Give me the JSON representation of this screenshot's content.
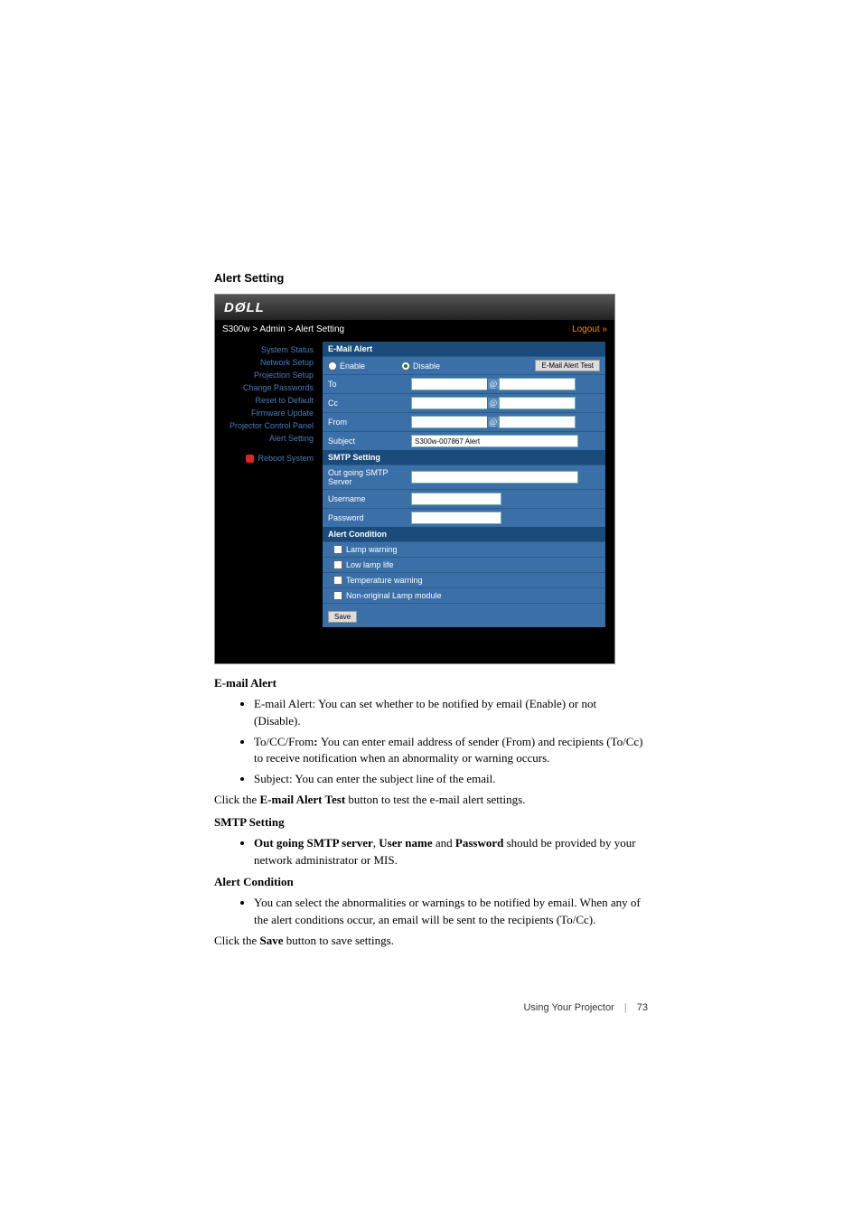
{
  "title": "Alert Setting",
  "screenshot": {
    "logo": "DØLL",
    "breadcrumb": "S300w > Admin > Alert Setting",
    "logout": "Logout »",
    "sidebar": {
      "items": [
        {
          "label": "System Status"
        },
        {
          "label": "Network Setup"
        },
        {
          "label": "Projection Setup"
        },
        {
          "label": "Change Passwords"
        },
        {
          "label": "Reset to Default"
        },
        {
          "label": "Firmware Update"
        },
        {
          "label": "Projector Control Panel"
        },
        {
          "label": "Alert Setting"
        }
      ],
      "reboot": "Reboot System"
    },
    "email_alert": {
      "header": "E-Mail Alert",
      "enable": "Enable",
      "disable": "Disable",
      "test_button": "E-Mail Alert Test",
      "to": "To",
      "cc": "Cc",
      "from": "From",
      "subject": "Subject",
      "subject_value": "S300w-007867 Alert",
      "at": "@"
    },
    "smtp": {
      "header": "SMTP Setting",
      "server": "Out going SMTP Server",
      "username": "Username",
      "password": "Password"
    },
    "condition": {
      "header": "Alert Condition",
      "items": [
        "Lamp warning",
        "Low lamp life",
        "Temperature warning",
        "Non-original Lamp module"
      ],
      "save": "Save"
    }
  },
  "doc": {
    "email_alert_heading": "E-mail Alert",
    "bullet1": "E-mail Alert: You can set whether to be notified by email (Enable) or not (Disable).",
    "bullet2a": "To/CC/From",
    "bullet2b": ": ",
    "bullet2c": "You can enter email address of sender (From) and recipients (To/Cc) to receive notification when an abnormality or warning occurs.",
    "bullet3": "Subject: You can enter the subject line of the email.",
    "para1a": "Click the ",
    "para1b": "E-mail Alert Test",
    "para1c": " button to test the e-mail alert settings.",
    "smtp_heading": "SMTP Setting",
    "bullet4a": "Out going SMTP server",
    "bullet4b": ", ",
    "bullet4c": "User name",
    "bullet4d": " and ",
    "bullet4e": "Password",
    "bullet4f": " should be provided by your network administrator or MIS.",
    "condition_heading": "Alert Condition",
    "bullet5": "You can select the abnormalities or warnings to be notified by email. When any of the alert conditions occur, an email will be sent to the recipients (To/Cc).",
    "para2a": "Click the ",
    "para2b": "Save",
    "para2c": " button to save settings.",
    "footer_text": "Using Your Projector",
    "page_num": "73"
  }
}
